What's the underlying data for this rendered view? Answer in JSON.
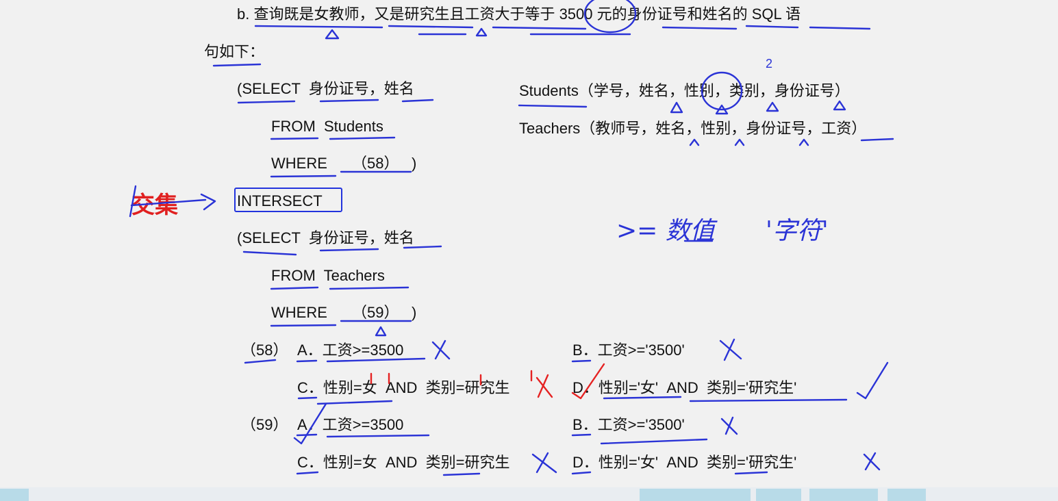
{
  "question": {
    "line1": "b. 查询既是女教师，又是研究生且工资大于等于 3500 元的身份证号和姓名的 SQL 语",
    "line2": "句如下："
  },
  "query": {
    "select1": "(SELECT  身份证号，姓名",
    "from1": "FROM  Students",
    "where1_kw": "WHERE",
    "where1_blank": "（58）",
    "where1_close": ")",
    "intersect": "INTERSECT",
    "select2": "(SELECT  身份证号，姓名",
    "from2": "FROM  Teachers",
    "where2_kw": "WHERE",
    "where2_blank": "（59）",
    "where2_close": ")"
  },
  "schema": {
    "students": "Students（学号，姓名，性别，类别，身份证号）",
    "teachers": "Teachers（教师号，姓名，性别，身份证号，工资）"
  },
  "annotations": {
    "jiaoji": "交集",
    "note_numeric": ">= 数值",
    "note_string": "'字符'",
    "circle_number": "2"
  },
  "options": {
    "q58": {
      "label": "（58）",
      "A": "A．工资>=3500",
      "B": "B．工资>='3500'",
      "C": "C．性别=女  AND  类别=研究生",
      "D": "D．性别='女'  AND  类别='研究生'"
    },
    "q59": {
      "label": "（59）",
      "A": "A．工资>=3500",
      "B": "B．工资>='3500'",
      "C": "C．性别=女  AND  类别=研究生",
      "D": "D．性别='女'  AND  类别='研究生'"
    }
  },
  "colors": {
    "ink_blue": "#2a33d6",
    "ink_red": "#e52222",
    "background": "#f1f1f1"
  }
}
